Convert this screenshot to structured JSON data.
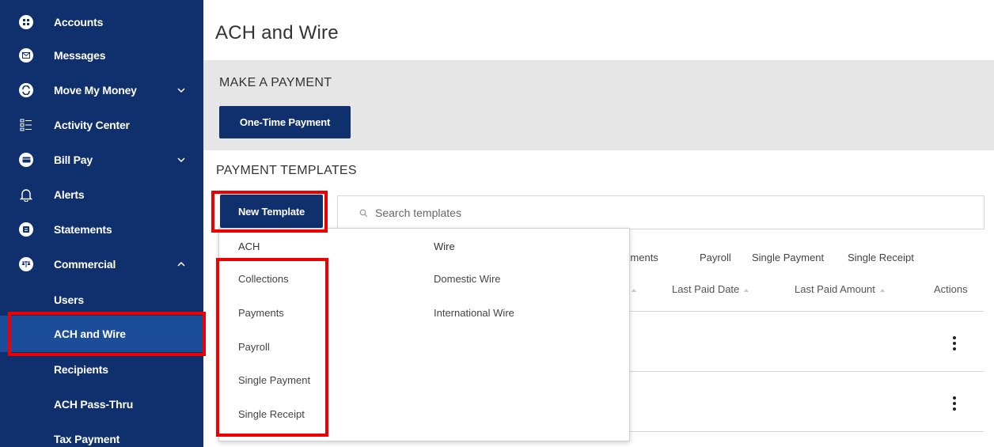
{
  "sidebar": {
    "items": [
      {
        "label": "Accounts",
        "icon": "accounts-icon"
      },
      {
        "label": "Messages",
        "icon": "messages-icon"
      },
      {
        "label": "Move My Money",
        "icon": "transfer-icon"
      },
      {
        "label": "Activity Center",
        "icon": "activity-list-icon"
      },
      {
        "label": "Bill Pay",
        "icon": "bill-pay-icon"
      },
      {
        "label": "Alerts",
        "icon": "bell-icon"
      },
      {
        "label": "Statements",
        "icon": "statements-icon"
      },
      {
        "label": "Commercial",
        "icon": "scale-icon"
      }
    ],
    "sub_items": [
      {
        "label": "Users"
      },
      {
        "label": "ACH and Wire"
      },
      {
        "label": "Recipients"
      },
      {
        "label": "ACH Pass-Thru"
      },
      {
        "label": "Tax Payment"
      }
    ],
    "active": "ACH and Wire"
  },
  "page": {
    "title": "ACH and Wire"
  },
  "make_payment": {
    "heading": "MAKE A PAYMENT",
    "button": "One-Time Payment"
  },
  "templates": {
    "heading": "PAYMENT TEMPLATES",
    "new_button": "New Template",
    "search_placeholder": "Search templates",
    "filters": [
      "Payments",
      "Payroll",
      "Single Payment",
      "Single Receipt"
    ],
    "columns": [
      "Last Paid Date",
      "Last Paid Amount",
      "Actions"
    ]
  },
  "dropdown": {
    "ach_header": "ACH",
    "ach_items": [
      "Collections",
      "Payments",
      "Payroll",
      "Single Payment",
      "Single Receipt"
    ],
    "wire_header": "Wire",
    "wire_items": [
      "Domestic Wire",
      "International Wire"
    ]
  },
  "colors": {
    "sidebar_bg": "#0f2f6d",
    "sidebar_active": "#1c4d9a",
    "primary_button": "#0f2f6d",
    "band_gray": "#e6e6e6",
    "highlight_red": "#ee0000"
  }
}
